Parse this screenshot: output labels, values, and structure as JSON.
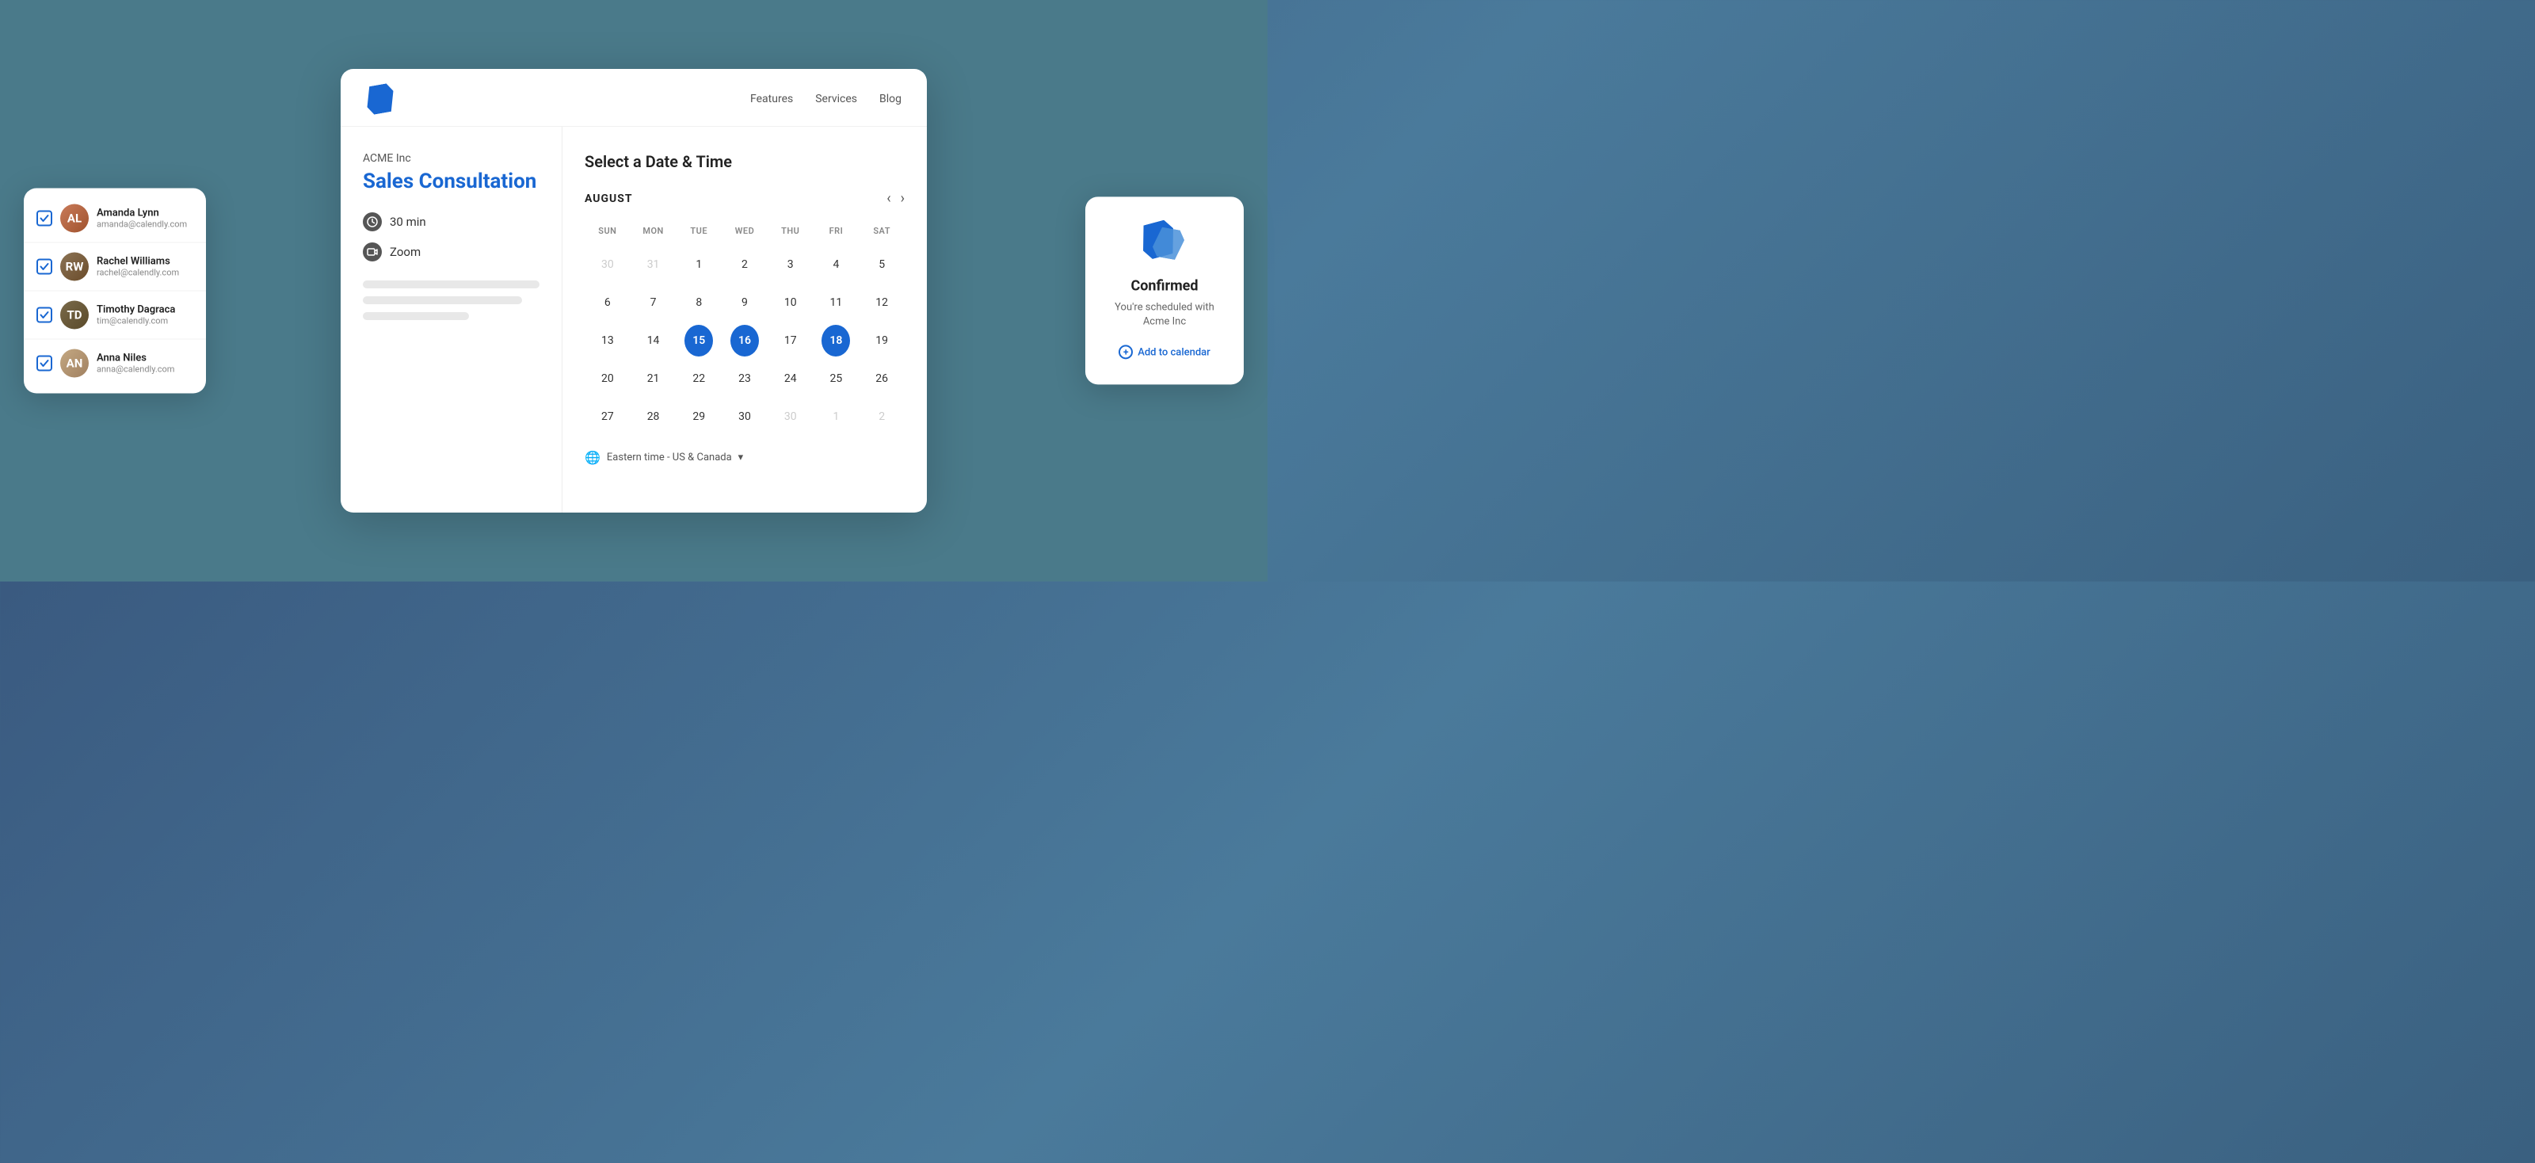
{
  "nav": {
    "features_label": "Features",
    "services_label": "Services",
    "blog_label": "Blog"
  },
  "company": {
    "name": "ACME Inc"
  },
  "event": {
    "title": "Sales Consultation",
    "duration": "30 min",
    "meeting_type": "Zoom"
  },
  "calendar": {
    "section_title": "Select a Date & Time",
    "month": "AUGUST",
    "weekdays": [
      "SUN",
      "MON",
      "TUE",
      "WED",
      "THU",
      "FRI",
      "SAT"
    ],
    "rows": [
      [
        {
          "day": "30",
          "type": "other-month"
        },
        {
          "day": "31",
          "type": "other-month"
        },
        {
          "day": "1",
          "type": "normal"
        },
        {
          "day": "2",
          "type": "normal"
        },
        {
          "day": "3",
          "type": "normal"
        },
        {
          "day": "4",
          "type": "normal"
        },
        {
          "day": "5",
          "type": "normal"
        }
      ],
      [
        {
          "day": "6",
          "type": "normal"
        },
        {
          "day": "7",
          "type": "normal"
        },
        {
          "day": "8",
          "type": "normal"
        },
        {
          "day": "9",
          "type": "normal"
        },
        {
          "day": "10",
          "type": "normal"
        },
        {
          "day": "11",
          "type": "normal"
        },
        {
          "day": "12",
          "type": "normal"
        }
      ],
      [
        {
          "day": "13",
          "type": "normal"
        },
        {
          "day": "14",
          "type": "normal"
        },
        {
          "day": "15",
          "type": "selected"
        },
        {
          "day": "16",
          "type": "selected"
        },
        {
          "day": "17",
          "type": "normal"
        },
        {
          "day": "18",
          "type": "selected"
        },
        {
          "day": "19",
          "type": "normal"
        }
      ],
      [
        {
          "day": "20",
          "type": "normal"
        },
        {
          "day": "21",
          "type": "normal"
        },
        {
          "day": "22",
          "type": "normal"
        },
        {
          "day": "23",
          "type": "normal"
        },
        {
          "day": "24",
          "type": "normal"
        },
        {
          "day": "25",
          "type": "normal"
        },
        {
          "day": "26",
          "type": "normal"
        }
      ],
      [
        {
          "day": "27",
          "type": "normal"
        },
        {
          "day": "28",
          "type": "normal"
        },
        {
          "day": "29",
          "type": "normal"
        },
        {
          "day": "30",
          "type": "normal"
        },
        {
          "day": "30",
          "type": "other-month"
        },
        {
          "day": "1",
          "type": "other-month"
        },
        {
          "day": "2",
          "type": "other-month"
        }
      ]
    ],
    "timezone_label": "Eastern time - US & Canada",
    "timezone_dropdown": "▾"
  },
  "users": [
    {
      "name": "Amanda Lynn",
      "email": "amanda@calendly.com",
      "initials": "AL",
      "avatar_class": "avatar-amanda"
    },
    {
      "name": "Rachel Williams",
      "email": "rachel@calendly.com",
      "initials": "RW",
      "avatar_class": "avatar-rachel"
    },
    {
      "name": "Timothy Dagraca",
      "email": "tim@calendly.com",
      "initials": "TD",
      "avatar_class": "avatar-timothy"
    },
    {
      "name": "Anna Niles",
      "email": "anna@calendly.com",
      "initials": "AN",
      "avatar_class": "avatar-anna"
    }
  ],
  "confirmation": {
    "title": "Confirmed",
    "subtitle": "You're scheduled with Acme Inc",
    "add_calendar_label": "Add to calendar"
  }
}
